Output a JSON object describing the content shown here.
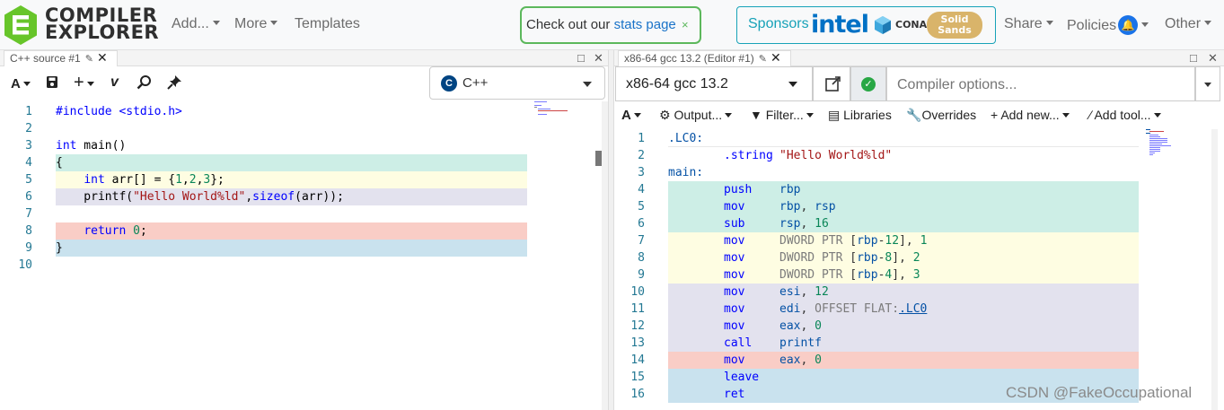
{
  "logo": {
    "line1": "COMPILER",
    "line2": "EXPLORER"
  },
  "nav": {
    "add": "Add...",
    "more": "More",
    "templates": "Templates",
    "stats_prefix": "Check out our",
    "stats_link": "stats page",
    "stats_close": "×",
    "sponsors_label": "Sponsors",
    "sponsor_intel": "intel",
    "sponsor_conan": "CONAN",
    "sponsor_solid_1": "Solid",
    "sponsor_solid_2": "Sands",
    "share": "Share",
    "policies": "Policies",
    "other": "Other"
  },
  "source_pane": {
    "tab_title": "C++ source #1",
    "language": "C++",
    "lines": [
      "#include <stdio.h>",
      "",
      "int main()",
      "{",
      "    int arr[] = {1,2,3};",
      "    printf(\"Hello World%ld\",sizeof(arr));",
      "",
      "    return 0;",
      "}",
      ""
    ],
    "highlight_colors": [
      "#ffffff",
      "#ffffff",
      "#ffffff",
      "#cdeee6",
      "#fefde2",
      "#e3e2ee",
      "#ffffff",
      "#f9cdc6",
      "#c9e2ee",
      "#ffffff"
    ]
  },
  "compiler_pane": {
    "tab_title": "x86-64 gcc 13.2 (Editor #1)",
    "compiler": "x86-64 gcc 13.2",
    "options_placeholder": "Compiler options...",
    "toolbar": {
      "output": "Output...",
      "filter": "Filter...",
      "libraries": "Libraries",
      "overrides": "Overrides",
      "add_new": "Add new...",
      "add_tool": "Add tool..."
    },
    "asm": [
      {
        "label": ".LC0:",
        "op": "",
        "args": ""
      },
      {
        "label": "",
        "op": ".string",
        "args": "\"Hello World%ld\""
      },
      {
        "label": "main:",
        "op": "",
        "args": ""
      },
      {
        "label": "",
        "op": "push",
        "args": "rbp"
      },
      {
        "label": "",
        "op": "mov",
        "args": "rbp, rsp"
      },
      {
        "label": "",
        "op": "sub",
        "args": "rsp, 16"
      },
      {
        "label": "",
        "op": "mov",
        "args": "DWORD PTR [rbp-12], 1"
      },
      {
        "label": "",
        "op": "mov",
        "args": "DWORD PTR [rbp-8], 2"
      },
      {
        "label": "",
        "op": "mov",
        "args": "DWORD PTR [rbp-4], 3"
      },
      {
        "label": "",
        "op": "mov",
        "args": "esi, 12"
      },
      {
        "label": "",
        "op": "mov",
        "args": "edi, OFFSET FLAT:.LC0"
      },
      {
        "label": "",
        "op": "mov",
        "args": "eax, 0"
      },
      {
        "label": "",
        "op": "call",
        "args": "printf"
      },
      {
        "label": "",
        "op": "mov",
        "args": "eax, 0"
      },
      {
        "label": "",
        "op": "leave",
        "args": ""
      },
      {
        "label": "",
        "op": "ret",
        "args": ""
      }
    ],
    "highlight_colors": [
      "#ffffff",
      "#ffffff",
      "#ffffff",
      "#cdeee6",
      "#cdeee6",
      "#cdeee6",
      "#fefde2",
      "#fefde2",
      "#fefde2",
      "#e3e2ee",
      "#e3e2ee",
      "#e3e2ee",
      "#e3e2ee",
      "#f9cdc6",
      "#c9e2ee",
      "#c9e2ee"
    ]
  },
  "watermark": "CSDN @FakeOccupational"
}
